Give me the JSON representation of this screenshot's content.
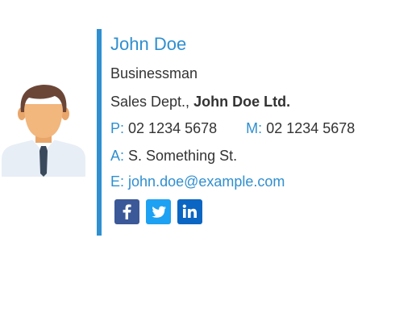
{
  "contact": {
    "name": "John Doe",
    "job_title": "Businessman",
    "department": "Sales Dept.,",
    "company": "John Doe Ltd.",
    "phone_label": "P:",
    "phone": "02 1234 5678",
    "mobile_label": "M:",
    "mobile": "02 1234 5678",
    "address_label": "A:",
    "address": "S. Something St.",
    "email_label": "E:",
    "email": "john.doe@example.com"
  },
  "social": [
    {
      "icon": "facebook-icon",
      "color": "#3b5998"
    },
    {
      "icon": "twitter-icon",
      "color": "#1da1f2"
    },
    {
      "icon": "linkedin-icon",
      "color": "#0a66c2"
    }
  ],
  "colors": {
    "accent": "#2f8fd0",
    "text": "#333333"
  }
}
